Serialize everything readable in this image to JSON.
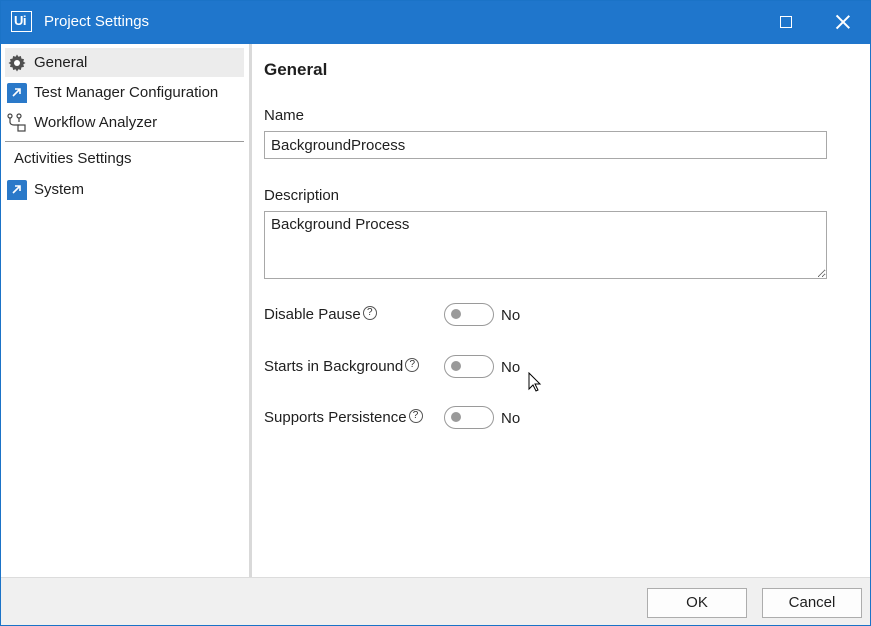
{
  "window": {
    "title": "Project Settings",
    "logo_text": "Ui",
    "accent_color": "#1f76cc"
  },
  "sidebar": {
    "items": [
      {
        "label": "General",
        "icon": "gear-icon",
        "selected": true
      },
      {
        "label": "Test Manager Configuration",
        "icon": "blue-arrow-icon"
      },
      {
        "label": "Workflow Analyzer",
        "icon": "workflow-analyzer-icon"
      }
    ],
    "section_label": "Activities Settings",
    "section_items": [
      {
        "label": "System",
        "icon": "blue-arrow-icon"
      }
    ]
  },
  "main": {
    "title": "General",
    "name_label": "Name",
    "name_value": "BackgroundProcess",
    "description_label": "Description",
    "description_value": "Background Process",
    "options": [
      {
        "label": "Disable Pause",
        "value": "No",
        "help_icon": "?"
      },
      {
        "label": "Starts in Background",
        "value": "No",
        "help_icon": "?"
      },
      {
        "label": "Supports Persistence",
        "value": "No",
        "help_icon": "?"
      }
    ]
  },
  "footer": {
    "ok_label": "OK",
    "cancel_label": "Cancel"
  }
}
